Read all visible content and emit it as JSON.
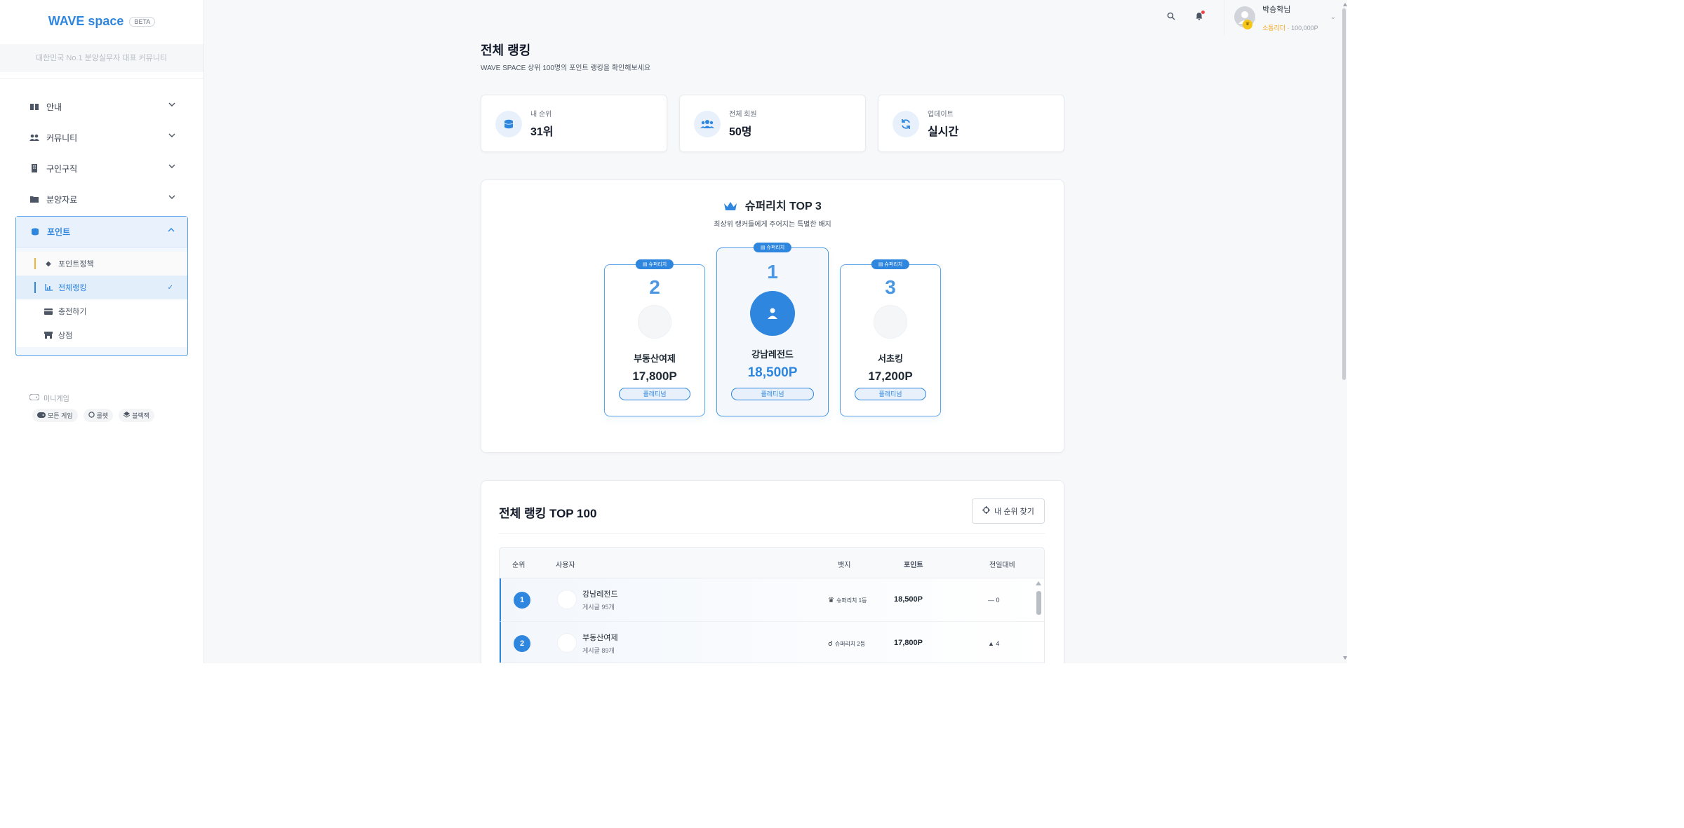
{
  "sidebar": {
    "logo": "WAVE space",
    "beta": "BETA",
    "tagline": "대한민국 No.1 분양실무자 대표 커뮤니티",
    "items": [
      {
        "label": "안내",
        "icon": "book-icon"
      },
      {
        "label": "커뮤니티",
        "icon": "users-icon"
      },
      {
        "label": "구인구직",
        "icon": "building-icon"
      },
      {
        "label": "분양자료",
        "icon": "folder-icon"
      }
    ],
    "points_group": {
      "label": "포인트",
      "icon": "coins-icon",
      "sub_items": [
        {
          "label": "포인트정책",
          "icon": "diamond-icon"
        },
        {
          "label": "전체랭킹",
          "icon": "chart-icon"
        },
        {
          "label": "충전하기",
          "icon": "card-icon"
        },
        {
          "label": "상점",
          "icon": "store-icon"
        }
      ]
    },
    "mini_games": {
      "title": "미니게임",
      "chips": [
        "모든 게임",
        "룰렛",
        "블랙잭"
      ]
    }
  },
  "header": {
    "user_name": "박승학님",
    "user_rank": "소통리더",
    "user_points": "100,000P"
  },
  "page": {
    "title": "전체 랭킹",
    "subtitle": "WAVE SPACE 상위 100명의 포인트 랭킹을 확인해보세요"
  },
  "stats": [
    {
      "label": "내 순위",
      "value": "31위",
      "icon": "coins-icon"
    },
    {
      "label": "전체 회원",
      "value": "50명",
      "icon": "users-icon"
    },
    {
      "label": "업데이트",
      "value": "실시간",
      "icon": "refresh-icon"
    }
  ],
  "top3": {
    "title": "슈퍼리치 TOP 3",
    "subtitle": "최상위 랭커들에게 주어지는 특별한 배지",
    "tag": "슈퍼리치",
    "second": {
      "rank": "2",
      "name": "부동산여제",
      "points": "17,800P",
      "badge": "플래티넘"
    },
    "first": {
      "rank": "1",
      "name": "강남레전드",
      "points": "18,500P",
      "badge": "플래티넘"
    },
    "third": {
      "rank": "3",
      "name": "서초킹",
      "points": "17,200P",
      "badge": "플래티넘"
    }
  },
  "ranking": {
    "title": "전체 랭킹 TOP 100",
    "find_button": "내 순위 찾기",
    "headers": {
      "rank": "순위",
      "user": "사용자",
      "badge": "뱃지",
      "points": "포인트",
      "diff": "전일대비"
    },
    "rows": [
      {
        "rank": "1",
        "name": "강남레전드",
        "posts": "게시글 95개",
        "badge": "슈퍼리치 1등",
        "points": "18,500P",
        "diff": "— 0"
      },
      {
        "rank": "2",
        "name": "부동산여제",
        "posts": "게시글 89개",
        "badge": "슈퍼리치 2등",
        "points": "17,800P",
        "diff": "▲ 4"
      }
    ]
  },
  "colors": {
    "accent": "#2e86de",
    "gold": "#f2b233",
    "notif": "#ef4444"
  }
}
